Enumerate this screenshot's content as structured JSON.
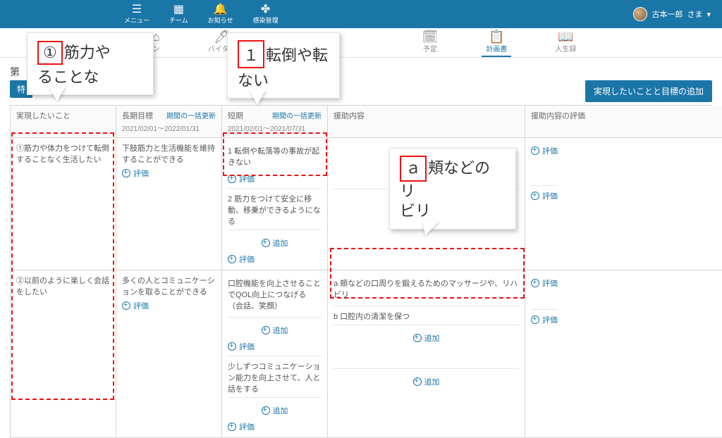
{
  "topnav": {
    "menu": "メニュー",
    "team": "チーム",
    "notice": "お知らせ",
    "infection": "感染管理"
  },
  "user": {
    "name": "古本一郎",
    "suffix": "さま",
    "caret": "▾"
  },
  "tabs": {
    "session": "ン",
    "vital": "バイタル",
    "schedule": "予定",
    "plan": "計画書",
    "life": "人生録"
  },
  "page": {
    "dai_prefix": "第",
    "special_btn": "特",
    "add_goal_btn": "実現したいことと目標の追加"
  },
  "headers": {
    "wish": "実現したいこと",
    "long": "長期目標",
    "long_range": "2021/02/01～2022/01/31",
    "short": "短期",
    "short_range": "2021/02/01～2021/07/31",
    "bulk": "期間の一括更新",
    "support": "援助内容",
    "support_eval": "援助内容の評価"
  },
  "actions": {
    "add": "追加",
    "eval": "評価"
  },
  "rows": [
    {
      "wish": "①筋力や体力をつけて転倒することなく生活したい",
      "long": "下肢筋力と生活機能を維持することができる",
      "shorts": [
        "1 転倒や転落等の事故が起きない",
        "2 筋力をつけて安全に移動、移乗ができるようになる"
      ],
      "supports": []
    },
    {
      "wish": "②以前のように楽しく会話をしたい",
      "long": "多くの人とコミュニケーションを取ることができる",
      "shorts": [
        "口腔機能を向上させることでQOL向上につなげる（会話、笑顔）",
        "少しずつコミュニケーション能力を向上させて、人と話をする"
      ],
      "supports": [
        "a 頬などの口周りを鍛えるためのマッサージや、リハビリ",
        "b 口腔内の清潔を保つ"
      ]
    }
  ],
  "callouts": {
    "c1_a": "①",
    "c1_b": "筋力や",
    "c1_c": "ることな",
    "c2_a": "１",
    "c2_b": "転倒や転",
    "c2_c": "ない",
    "c3_a": "ａ",
    "c3_b": "頬などのリ",
    "c3_c": "ビリ"
  }
}
